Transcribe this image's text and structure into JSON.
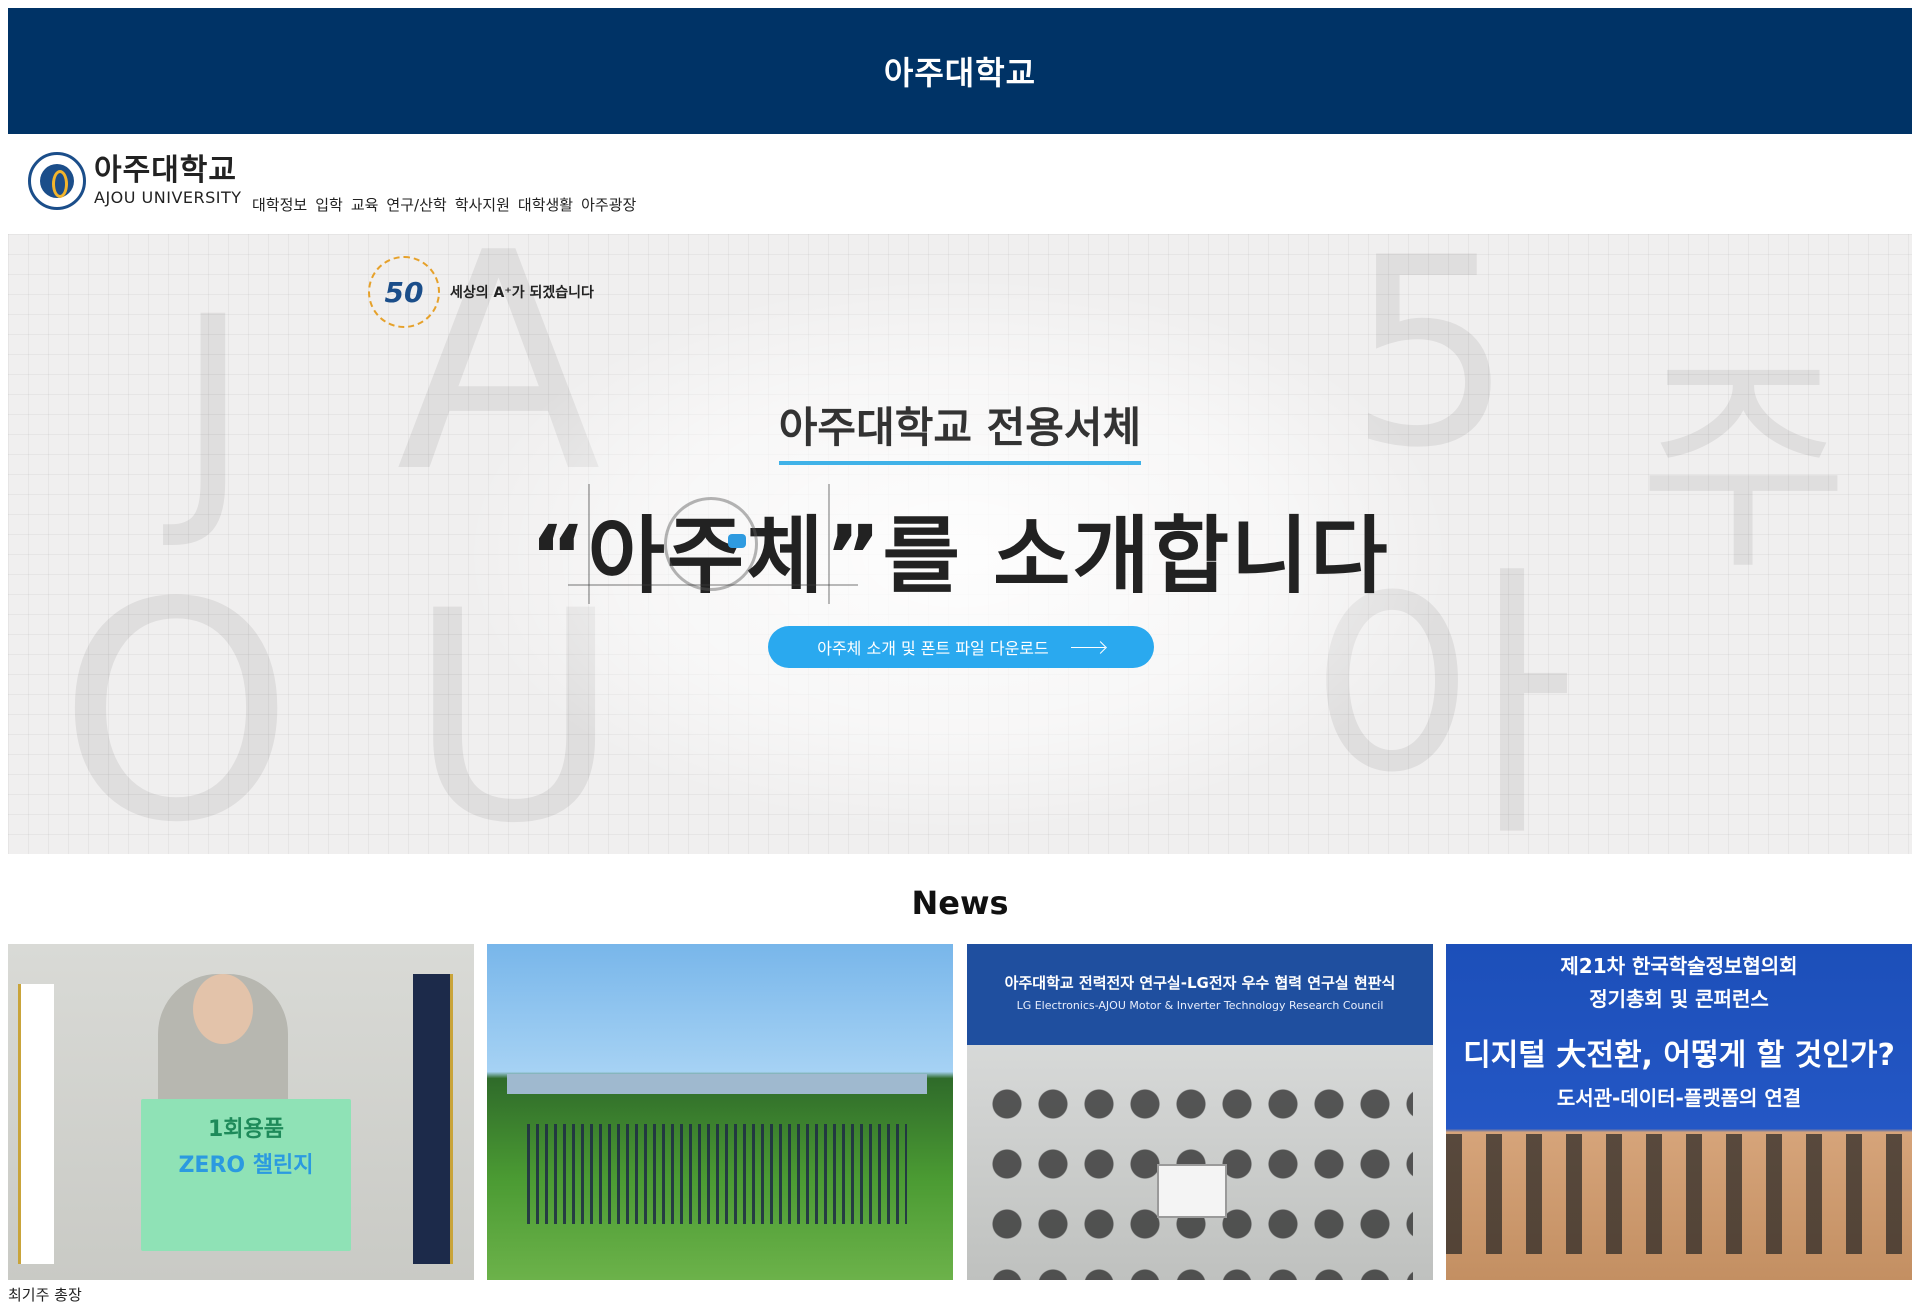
{
  "topbar": {
    "title": "아주대학교"
  },
  "header": {
    "logo_ko": "아주대학교",
    "logo_en": "AJOU UNIVERSITY",
    "nav": [
      "대학정보",
      "입학",
      "교육",
      "연구/산학",
      "학사지원",
      "대학생활",
      "아주광장"
    ]
  },
  "hero": {
    "anniversary_mark": "50",
    "slogan": "세상의 A⁺가 되겠습니다",
    "subtitle": "아주대학교 전용서체",
    "headline": "“아주체”를 소개합니다",
    "button_label": "아주체 소개 및 폰트 파일 다운로드",
    "background_letters": {
      "j": "J",
      "a": "A",
      "o": "O",
      "u": "U",
      "five": "5",
      "ju": "주",
      "a_ko": "아"
    }
  },
  "news": {
    "title": "News",
    "cards": [
      {
        "board_line1": "1회용품",
        "board_line2": "ZERO 챌린지"
      },
      {},
      {
        "banner_line1": "아주대학교 전력전자 연구실-LG전자 우수 협력 연구실 현판식",
        "banner_line2": "LG Electronics-AJOU Motor & Inverter Technology Research Council"
      },
      {
        "line1": "제21차 한국학술정보협의회",
        "line2": "정기총회 및 콘퍼런스",
        "line3": "디지털 大전환, 어떻게 할 것인가?",
        "line4": "도서관-데이터-플랫폼의 연결"
      }
    ],
    "caption": "최기주 총장"
  },
  "colors": {
    "topbar": "#003366",
    "accent": "#2aa9ef",
    "underline": "#40b2e8"
  }
}
